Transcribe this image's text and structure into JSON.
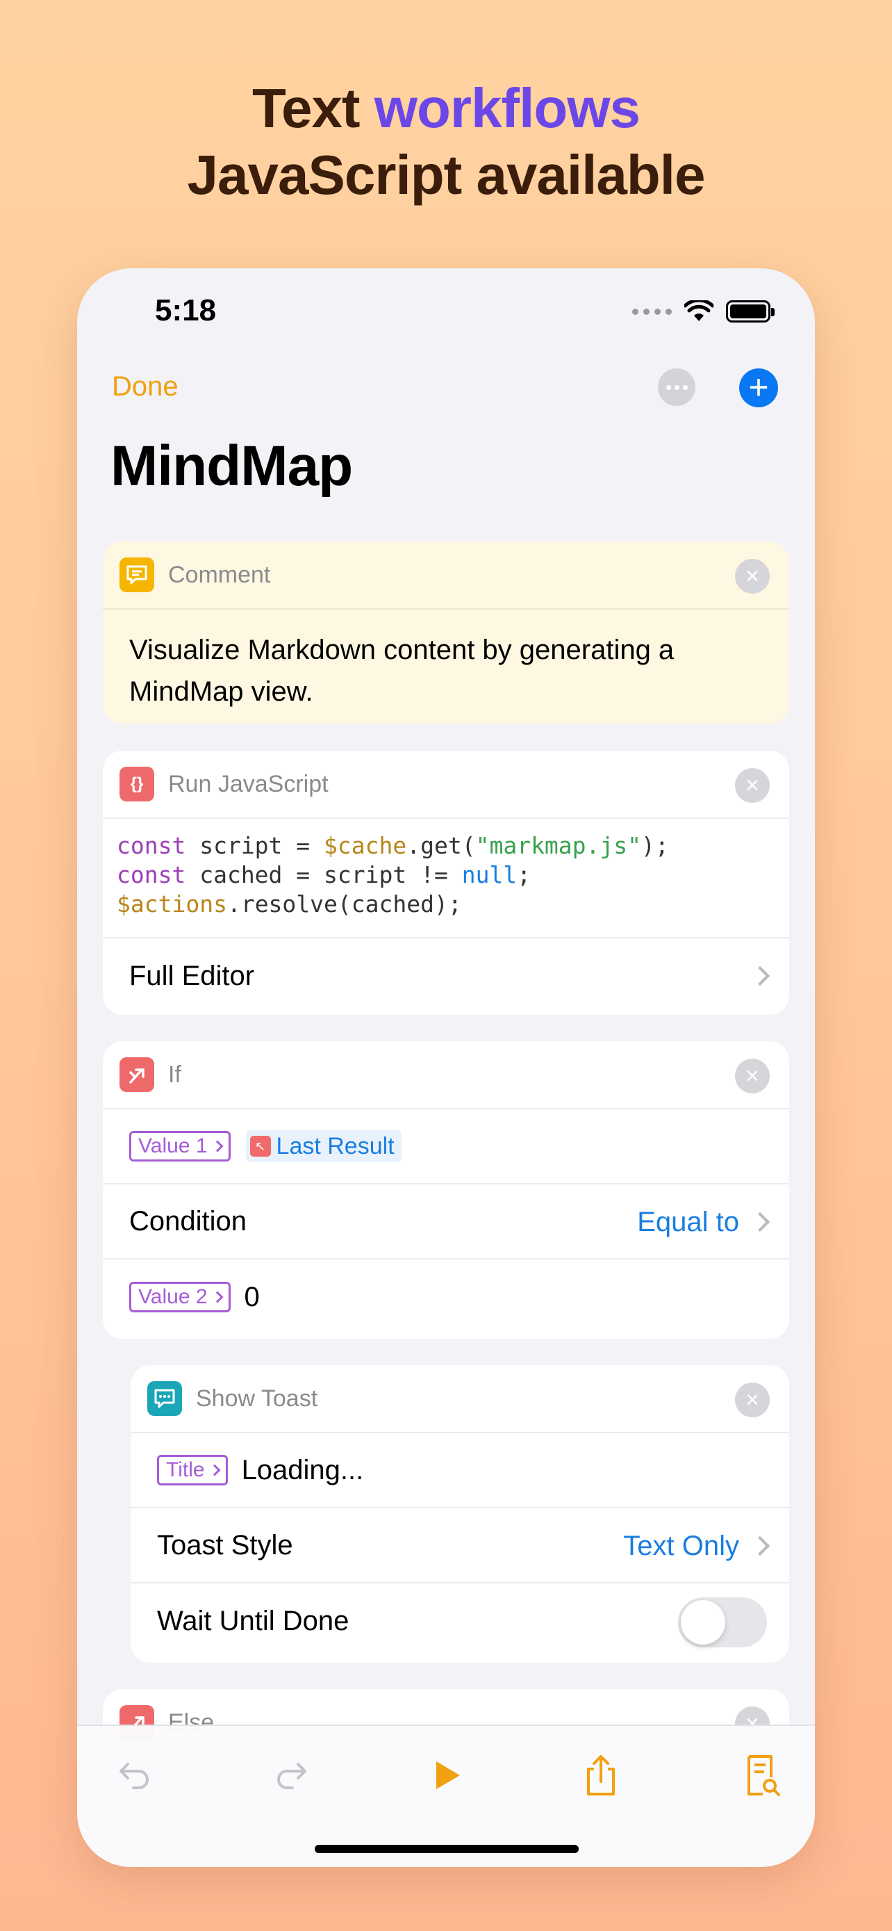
{
  "headline": {
    "line1_prefix": "Text ",
    "line1_accent": "workflows",
    "line2": "JavaScript available"
  },
  "status": {
    "time": "5:18"
  },
  "nav": {
    "done": "Done",
    "title": "MindMap"
  },
  "cards": {
    "comment": {
      "name": "Comment",
      "text": "Visualize Markdown content by generating a MindMap view."
    },
    "js": {
      "name": "Run JavaScript",
      "code": {
        "l1": [
          "const",
          " script = ",
          "$cache",
          ".get(",
          "\"markmap.js\"",
          ");"
        ],
        "l2": [
          "const",
          " cached = script != ",
          "null",
          ";"
        ],
        "l3": [
          "$actions",
          ".resolve(cached);"
        ]
      },
      "full_editor": "Full Editor"
    },
    "if": {
      "name": "If",
      "value1_tag": "Value 1",
      "last_result": "Last Result",
      "condition_label": "Condition",
      "condition_value": "Equal to",
      "value2_tag": "Value 2",
      "value2": "0"
    },
    "toast": {
      "name": "Show Toast",
      "title_tag": "Title",
      "title_value": "Loading...",
      "style_label": "Toast Style",
      "style_value": "Text Only",
      "wait_label": "Wait Until Done",
      "wait_enabled": false
    },
    "else": {
      "name": "Else"
    }
  },
  "icons": {
    "comment": "comment-bubble-icon",
    "js": "braces-icon",
    "if": "branch-icon",
    "toast": "message-bubble-icon",
    "toolbar": [
      "undo-icon",
      "redo-icon",
      "play-icon",
      "share-icon",
      "document-search-icon"
    ]
  },
  "colors": {
    "accent_orange": "#F0A010",
    "link_blue": "#1A7EE0",
    "headline_accent": "#6C47E8"
  }
}
